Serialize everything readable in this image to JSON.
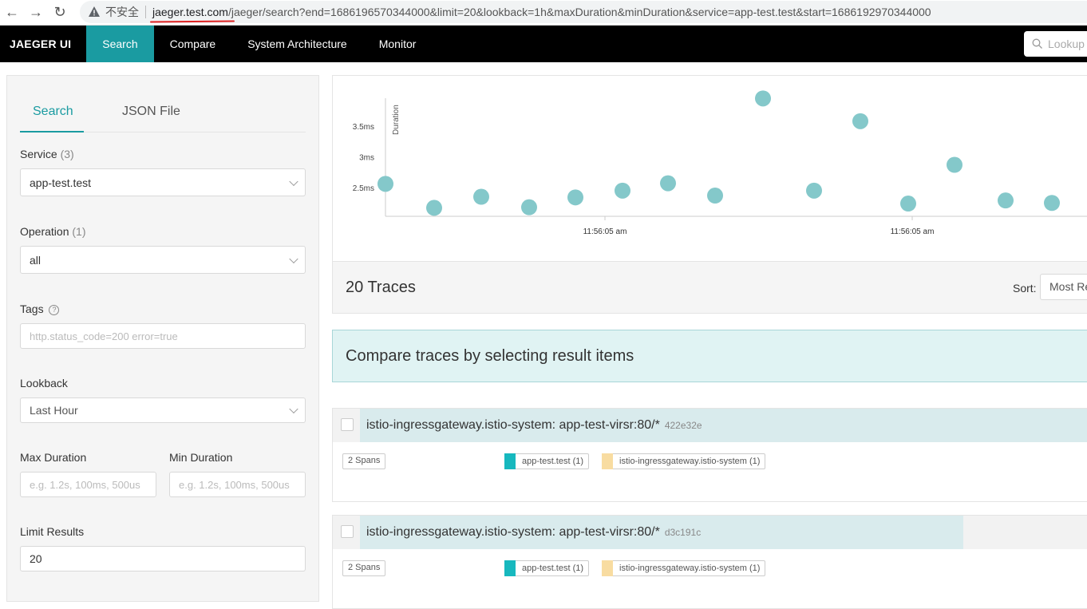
{
  "browser": {
    "insecure_label": "不安全",
    "url_host": "jaeger.test.com",
    "url_path": "/jaeger/search?end=1686196570344000&limit=20&lookback=1h&maxDuration&minDuration&service=app-test.test&start=1686192970344000"
  },
  "nav": {
    "brand": "JAEGER UI",
    "items": [
      "Search",
      "Compare",
      "System Architecture",
      "Monitor"
    ],
    "lookup_placeholder": "Lookup"
  },
  "search": {
    "tabs": [
      "Search",
      "JSON File"
    ],
    "service_label": "Service",
    "service_count": "(3)",
    "service_value": "app-test.test",
    "operation_label": "Operation",
    "operation_count": "(1)",
    "operation_value": "all",
    "tags_label": "Tags",
    "tags_placeholder": "http.status_code=200 error=true",
    "lookback_label": "Lookback",
    "lookback_value": "Last Hour",
    "max_duration_label": "Max Duration",
    "min_duration_label": "Min Duration",
    "duration_placeholder": "e.g. 1.2s, 100ms, 500us",
    "limit_label": "Limit Results",
    "limit_value": "20"
  },
  "chart_data": {
    "type": "scatter",
    "title": "",
    "ylabel": "Duration",
    "y_ticks": [
      "2.5ms",
      "3ms",
      "3.5ms"
    ],
    "x_ticks": [
      "11:56:05 am",
      "11:56:05 am"
    ],
    "point_color": "#84c8ca",
    "points_ms": [
      2.56,
      2.17,
      2.35,
      2.18,
      2.34,
      2.45,
      2.57,
      2.37,
      3.95,
      2.45,
      3.58,
      2.24,
      2.87,
      2.29,
      2.25
    ]
  },
  "results": {
    "count_label": "20 Traces",
    "sort_label": "Sort:",
    "sort_value": "Most Recent",
    "compare_banner": "Compare traces by selecting result items"
  },
  "traces": [
    {
      "title": "istio-ingressgateway.istio-system: app-test-virsr:80/*",
      "id": "422e32e",
      "spans": "2 Spans",
      "services": [
        {
          "name": "app-test.test (1)",
          "color": "#17b8be"
        },
        {
          "name": "istio-ingressgateway.istio-system (1)",
          "color": "#f8dca1"
        }
      ]
    },
    {
      "title": "istio-ingressgateway.istio-system: app-test-virsr:80/*",
      "id": "d3c191c",
      "spans": "2 Spans",
      "services": [
        {
          "name": "app-test.test (1)",
          "color": "#17b8be"
        },
        {
          "name": "istio-ingressgateway.istio-system (1)",
          "color": "#f8dca1"
        }
      ]
    }
  ]
}
